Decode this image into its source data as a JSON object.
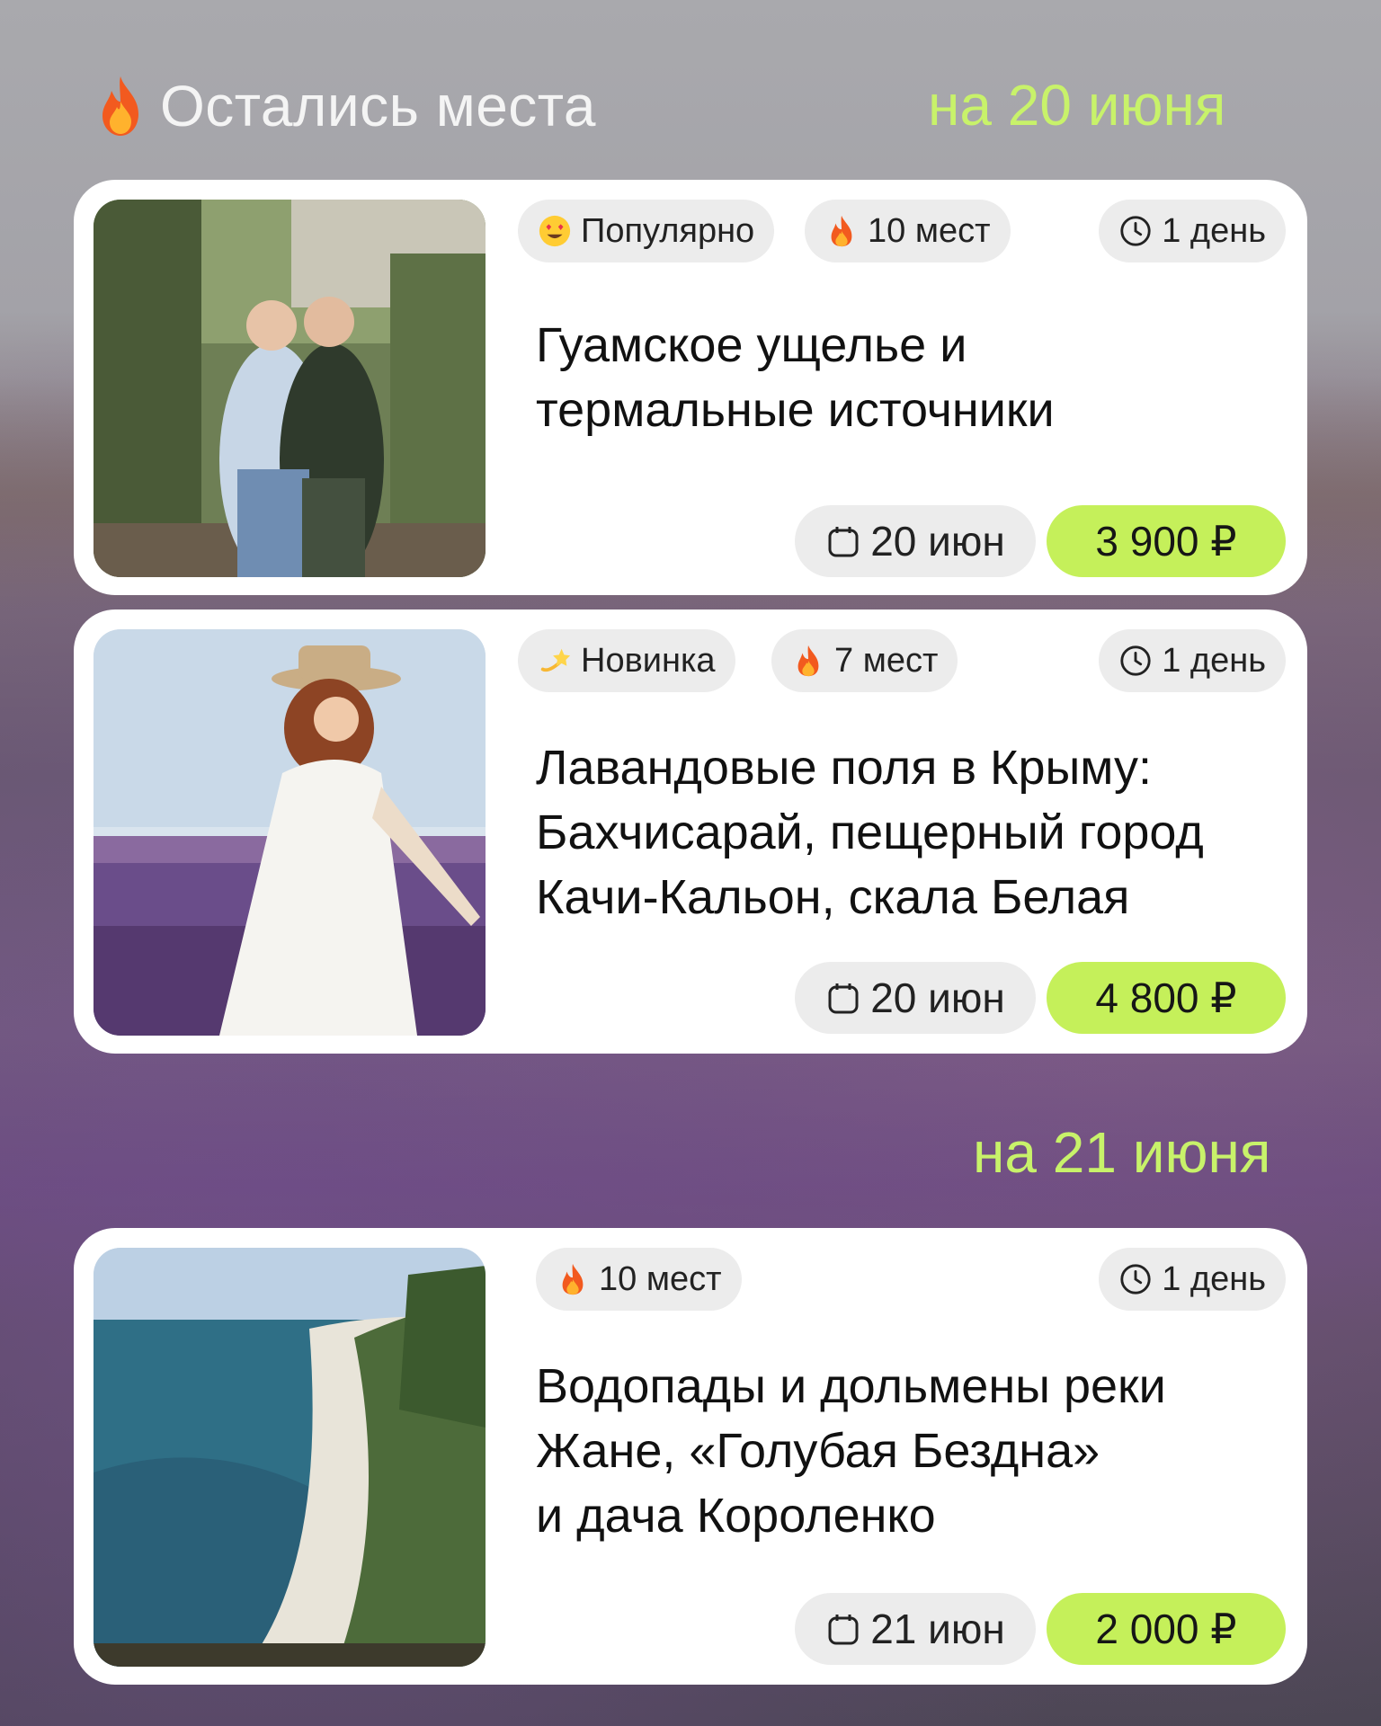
{
  "header": {
    "title": "Остались места",
    "date_20": "на 20 июня",
    "date_21": "на 21 июня"
  },
  "cards": [
    {
      "tags": [
        "Популярно",
        "10 мест"
      ],
      "duration": "1 день",
      "title_lines": [
        "Гуамское ущелье и",
        "термальные источники"
      ],
      "date": "20 июн",
      "price": "3 900 ₽"
    },
    {
      "tags": [
        "Новинка",
        "7 мест"
      ],
      "duration": "1 день",
      "title_lines": [
        "Лавандовые поля в Крыму:",
        "Бахчисарай, пещерный город",
        "Качи-Кальон, скала Белая"
      ],
      "date": "20 июн",
      "price": "4 800 ₽"
    },
    {
      "tags": [
        "10 мест"
      ],
      "duration": "1 день",
      "title_lines": [
        "Водопады и дольмены реки",
        "Жане, «Голубая Бездна»",
        "и дача Короленко"
      ],
      "date": "21 июн",
      "price": "2 000 ₽"
    }
  ],
  "icons": {
    "fire": "fire-icon",
    "popular": "heart-eyes-emoji-icon",
    "new": "dizzy-star-emoji-icon",
    "clock": "clock-icon",
    "calendar": "calendar-icon"
  },
  "colors": {
    "accent_green": "#c5f05a",
    "date_label": "#c8f26a",
    "chip_gray": "#ececec",
    "card_bg": "#ffffff"
  }
}
